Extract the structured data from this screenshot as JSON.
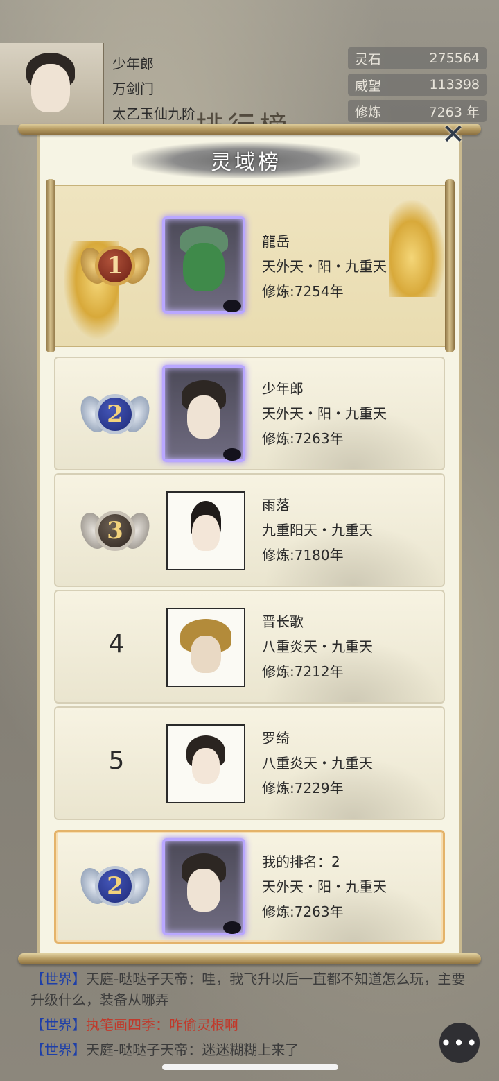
{
  "header": {
    "player_name": "少年郎",
    "sect": "万剑门",
    "realm": "太乙玉仙九阶",
    "stats": [
      {
        "label": "灵石",
        "value": "275564"
      },
      {
        "label": "威望",
        "value": "113398"
      },
      {
        "label": "修炼",
        "value": "7263 年"
      }
    ],
    "bg_title": "排行榜"
  },
  "dialog": {
    "title": "灵域榜",
    "close_symbol": "✕",
    "entries": [
      {
        "rank": "1",
        "name": "龍岳",
        "realm": "天外天・阳・九重天",
        "cultivation": "修炼:7254年"
      },
      {
        "rank": "2",
        "name": "少年郎",
        "realm": "天外天・阳・九重天",
        "cultivation": "修炼:7263年"
      },
      {
        "rank": "3",
        "name": "雨落",
        "realm": "九重阳天・九重天",
        "cultivation": "修炼:7180年"
      },
      {
        "rank": "4",
        "name": "晋长歌",
        "realm": "八重炎天・九重天",
        "cultivation": "修炼:7212年"
      },
      {
        "rank": "5",
        "name": "罗绮",
        "realm": "八重炎天・九重天",
        "cultivation": "修炼:7229年"
      }
    ],
    "mine": {
      "rank": "2",
      "label": "我的排名：2",
      "realm": "天外天・阳・九重天",
      "cultivation": "修炼:7263年"
    }
  },
  "chat": {
    "lines": [
      {
        "channel": "【世界】",
        "speaker": "天庭-哒哒子天帝：",
        "message": "哇，我飞升以后一直都不知道怎么玩，主要升级什么，装备从哪弄"
      },
      {
        "channel": "【世界】",
        "speaker": "执笔画四季：",
        "message": "咋偷灵根啊"
      },
      {
        "channel": "【世界】",
        "speaker": "天庭-哒哒子天帝：",
        "message": "迷迷糊糊上来了"
      }
    ],
    "button_symbol": "•••"
  },
  "colors": {
    "channel": "#1e3fa8",
    "highlight_name": "#c0392b",
    "gold_border": "#e4b36a"
  }
}
